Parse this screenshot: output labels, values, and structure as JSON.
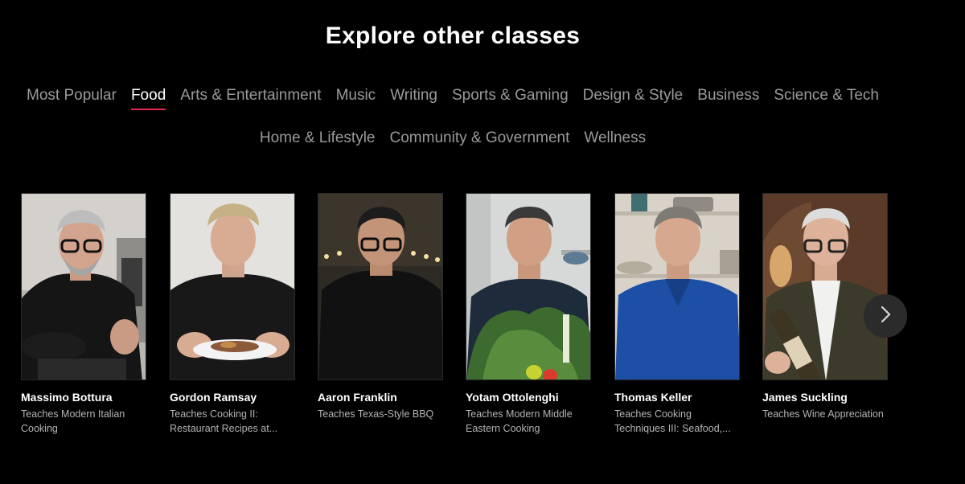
{
  "title": "Explore other classes",
  "tabs_row1": [
    "Most Popular",
    "Food",
    "Arts & Entertainment",
    "Music",
    "Writing",
    "Sports & Gaming",
    "Design & Style",
    "Business",
    "Science & Tech"
  ],
  "tabs_row2": [
    "Home & Lifestyle",
    "Community & Government",
    "Wellness"
  ],
  "active_tab": "Food",
  "accent_color": "#e32652",
  "instructors": [
    {
      "name": "Massimo Bottura",
      "desc": "Teaches Modern Italian Cooking"
    },
    {
      "name": "Gordon Ramsay",
      "desc": "Teaches Cooking II: Restaurant Recipes at..."
    },
    {
      "name": "Aaron Franklin",
      "desc": "Teaches Texas-Style BBQ"
    },
    {
      "name": "Yotam Ottolenghi",
      "desc": "Teaches Modern Middle Eastern Cooking"
    },
    {
      "name": "Thomas Keller",
      "desc": "Teaches Cooking Techniques III: Seafood,..."
    },
    {
      "name": "James Suckling",
      "desc": "Teaches Wine Appreciation"
    }
  ],
  "next_icon": "chevron-right-icon"
}
